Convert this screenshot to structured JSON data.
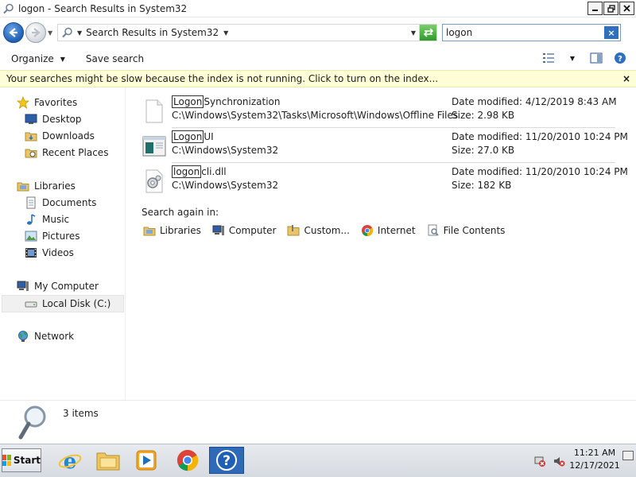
{
  "window": {
    "title": "logon - Search Results in System32"
  },
  "address": {
    "crumb": "Search Results in System32"
  },
  "search": {
    "value": "logon",
    "clear_label": "×"
  },
  "toolbar": {
    "organize_label": "Organize",
    "save_search_label": "Save search"
  },
  "infobar": {
    "message": "Your searches might be slow because the index is not running.  Click to turn on the index...",
    "close_label": "×"
  },
  "nav": {
    "favorites": "Favorites",
    "desktop": "Desktop",
    "downloads": "Downloads",
    "recent_places": "Recent Places",
    "libraries": "Libraries",
    "documents": "Documents",
    "music": "Music",
    "pictures": "Pictures",
    "videos": "Videos",
    "my_computer": "My Computer",
    "local_disk": "Local Disk (C:)",
    "network": "Network"
  },
  "results": [
    {
      "name_match": "Logon",
      "name_rest": "Synchronization",
      "path": "C:\\Windows\\System32\\Tasks\\Microsoft\\Windows\\Offline Files",
      "date": "Date modified: 4/12/2019 8:43 AM",
      "size": "Size: 2.98 KB",
      "icon": "blank-file-icon"
    },
    {
      "name_match": "Logon",
      "name_rest": "UI",
      "path": "C:\\Windows\\System32",
      "date": "Date modified: 11/20/2010 10:24 PM",
      "size": "Size: 27.0 KB",
      "icon": "application-icon"
    },
    {
      "name_match": "logon",
      "name_rest": "cli.dll",
      "path": "C:\\Windows\\System32",
      "date": "Date modified: 11/20/2010 10:24 PM",
      "size": "Size: 182 KB",
      "icon": "dll-gear-icon"
    }
  ],
  "search_again": {
    "label": "Search again in:",
    "links": [
      "Libraries",
      "Computer",
      "Custom...",
      "Internet",
      "File Contents"
    ]
  },
  "details": {
    "count": "3 items"
  },
  "taskbar": {
    "start_label": "Start",
    "time": "11:21 AM",
    "date": "12/17/2021"
  },
  "colors": {
    "infobar_bg": "#fefed6",
    "accent_blue": "#2f6ab8",
    "refresh_green": "#2f9a2a"
  }
}
